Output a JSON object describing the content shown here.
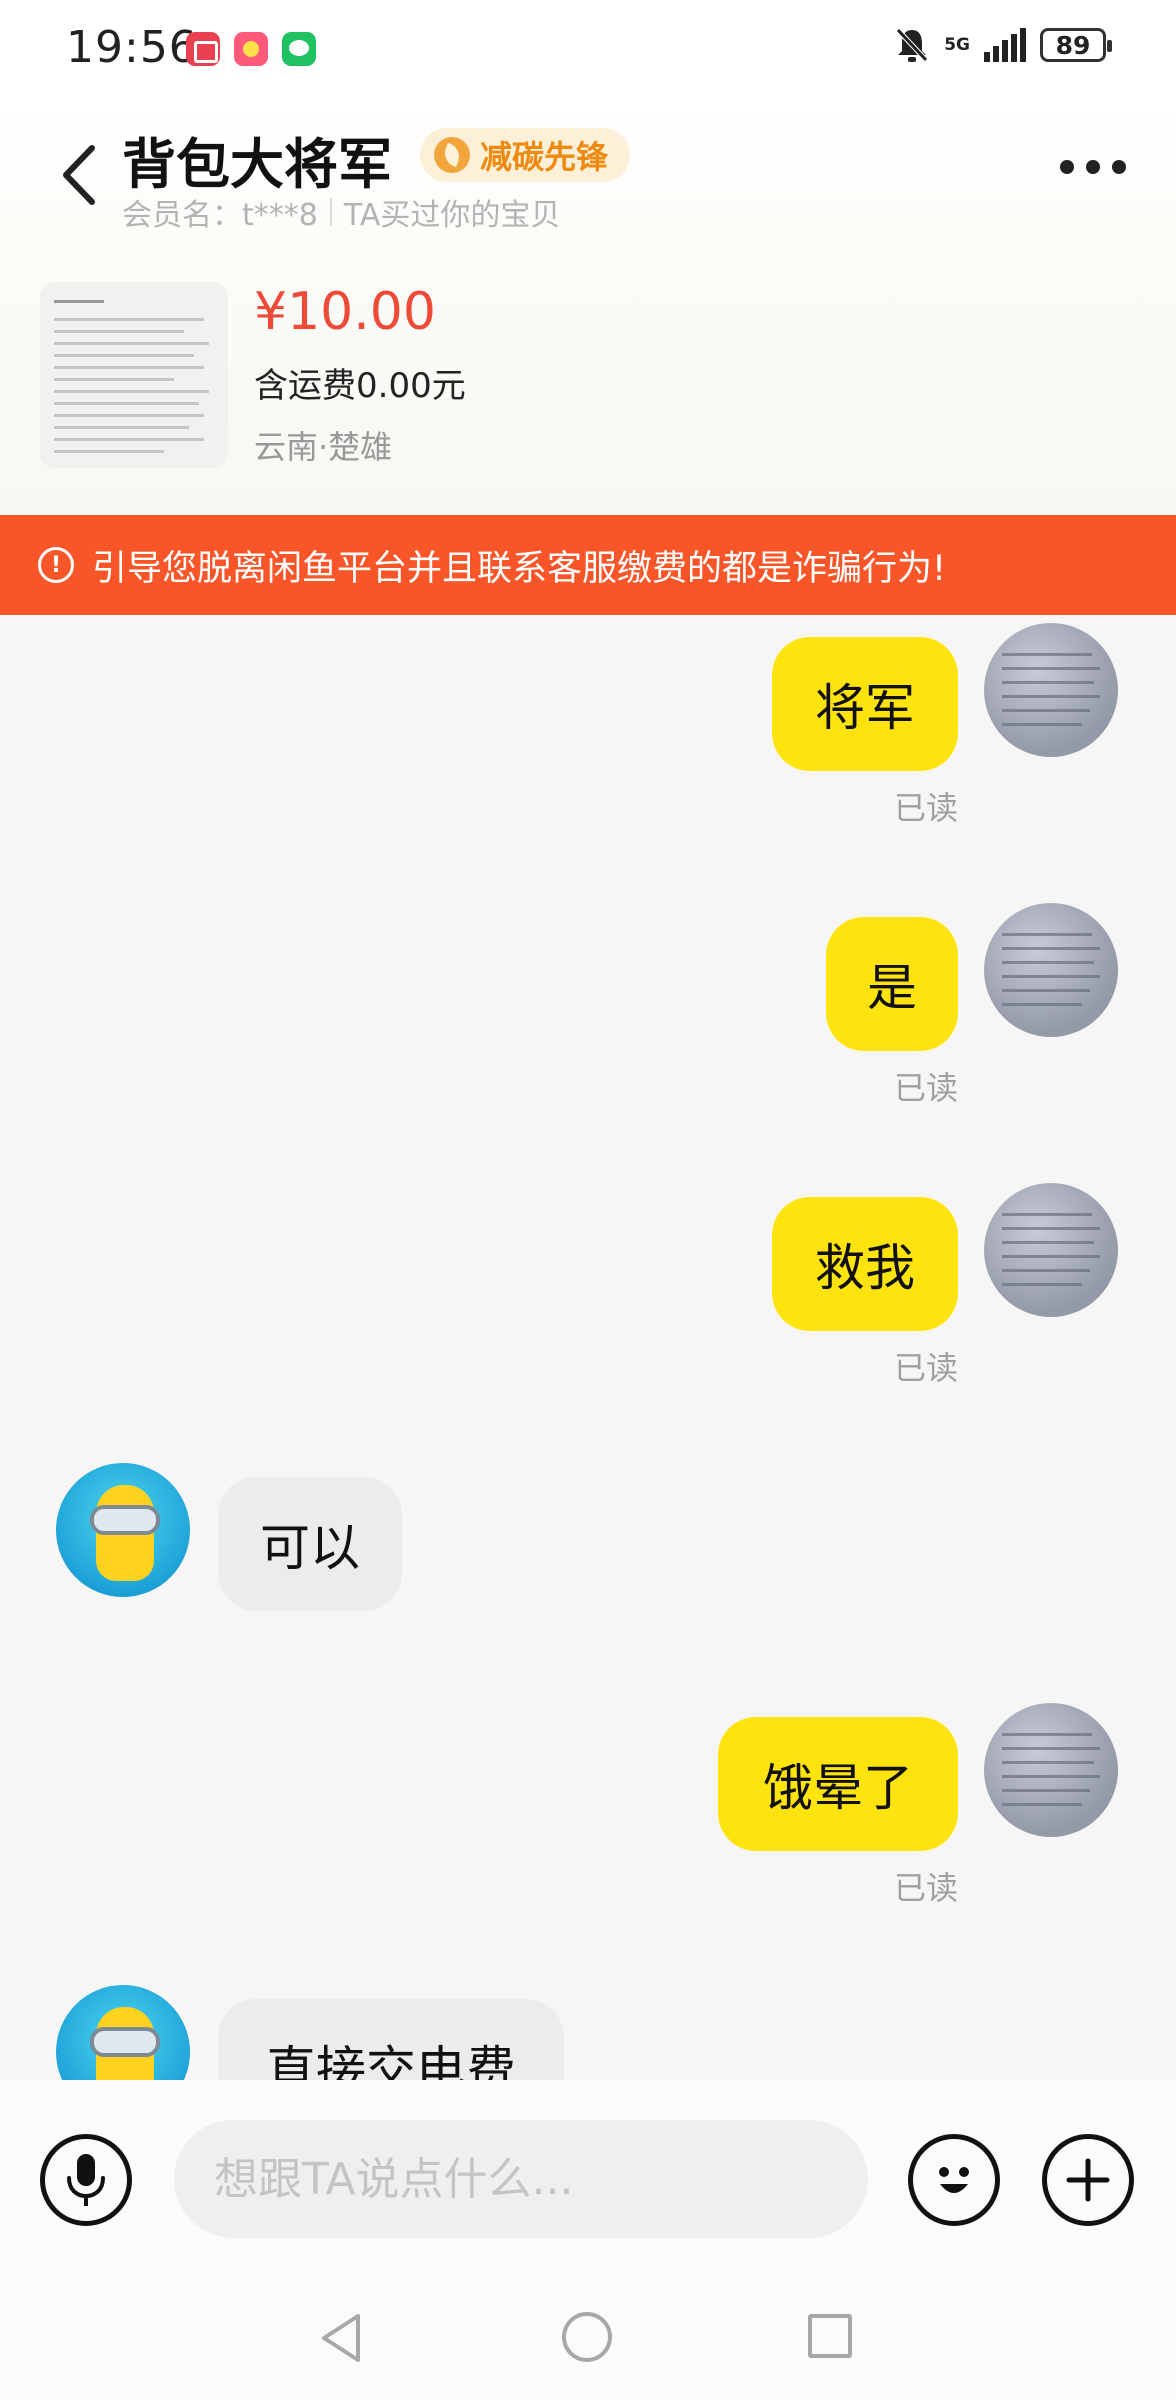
{
  "status_bar": {
    "time": "19:56",
    "network": "5G",
    "battery": "89",
    "app_icons": [
      "reading-app-icon",
      "game-app-icon",
      "wechat-icon"
    ]
  },
  "header": {
    "title": "背包大将军",
    "badge": "减碳先锋",
    "member_name": "会员名：t***8",
    "relation": "TA买过你的宝贝"
  },
  "product": {
    "price": "¥10.00",
    "shipping": "含运费0.00元",
    "location": "云南·楚雄"
  },
  "warning": {
    "text": "引导您脱离闲鱼平台并且联系客服缴费的都是诈骗行为!"
  },
  "messages": [
    {
      "from": "self",
      "text": "将军",
      "status": "已读"
    },
    {
      "from": "self",
      "text": "是",
      "status": "已读"
    },
    {
      "from": "self",
      "text": "救我",
      "status": "已读"
    },
    {
      "from": "peer",
      "text": "可以"
    },
    {
      "from": "self",
      "text": "饿晕了",
      "status": "已读"
    },
    {
      "from": "peer",
      "text": "直接交电费"
    }
  ],
  "input": {
    "placeholder": "想跟TA说点什么..."
  },
  "colors": {
    "accent_yellow": "#ffe30f",
    "warning_orange": "#f85528",
    "price_red": "#ee4a38",
    "badge_orange": "#ef8a10"
  }
}
